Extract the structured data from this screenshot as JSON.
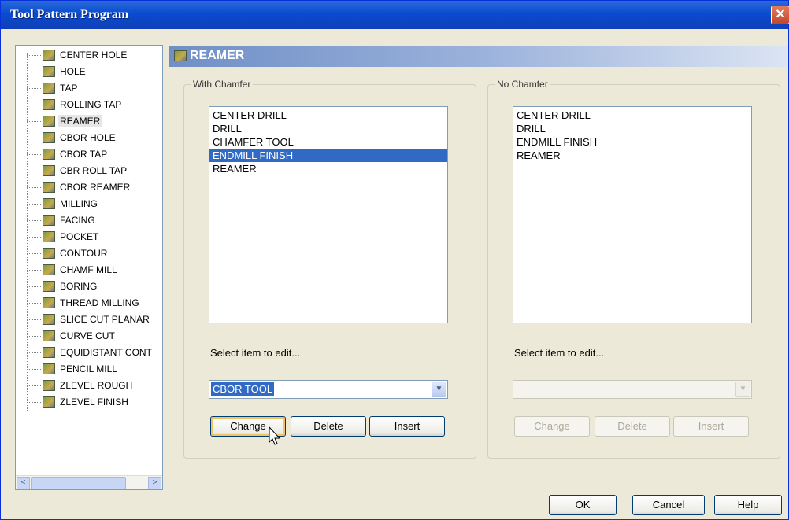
{
  "window": {
    "title": "Tool Pattern Program",
    "close_glyph": "✕"
  },
  "tree": {
    "items": [
      "CENTER HOLE",
      "HOLE",
      "TAP",
      "ROLLING TAP",
      "REAMER",
      "CBOR HOLE",
      "CBOR TAP",
      "CBR ROLL TAP",
      "CBOR REAMER",
      "MILLING",
      "FACING",
      "POCKET",
      "CONTOUR",
      "CHAMF MILL",
      "BORING",
      "THREAD MILLING",
      "SLICE CUT PLANAR",
      "CURVE CUT",
      "EQUIDISTANT CONT",
      "PENCIL MILL",
      "ZLEVEL ROUGH",
      "ZLEVEL FINISH"
    ],
    "selected": "REAMER",
    "scroll_left": "<",
    "scroll_right": ">"
  },
  "header": {
    "title": "REAMER"
  },
  "with_chamfer": {
    "title": "With Chamfer",
    "items": [
      "CENTER DRILL",
      "DRILL",
      "CHAMFER TOOL",
      "ENDMILL FINISH",
      "REAMER"
    ],
    "selected": "ENDMILL FINISH",
    "select_label": "Select item to edit...",
    "combo_value": "CBOR TOOL",
    "change_label": "Change",
    "delete_label": "Delete",
    "insert_label": "Insert"
  },
  "no_chamfer": {
    "title": "No Chamfer",
    "items": [
      "CENTER DRILL",
      "DRILL",
      "ENDMILL FINISH",
      "REAMER"
    ],
    "select_label": "Select item to edit...",
    "change_label": "Change",
    "delete_label": "Delete",
    "insert_label": "Insert"
  },
  "footer": {
    "ok_label": "OK",
    "cancel_label": "Cancel",
    "help_label": "Help"
  },
  "colors": {
    "title_blue": "#0a4bd0",
    "selection": "#316ac5",
    "dialog_bg": "#ece9d8"
  }
}
